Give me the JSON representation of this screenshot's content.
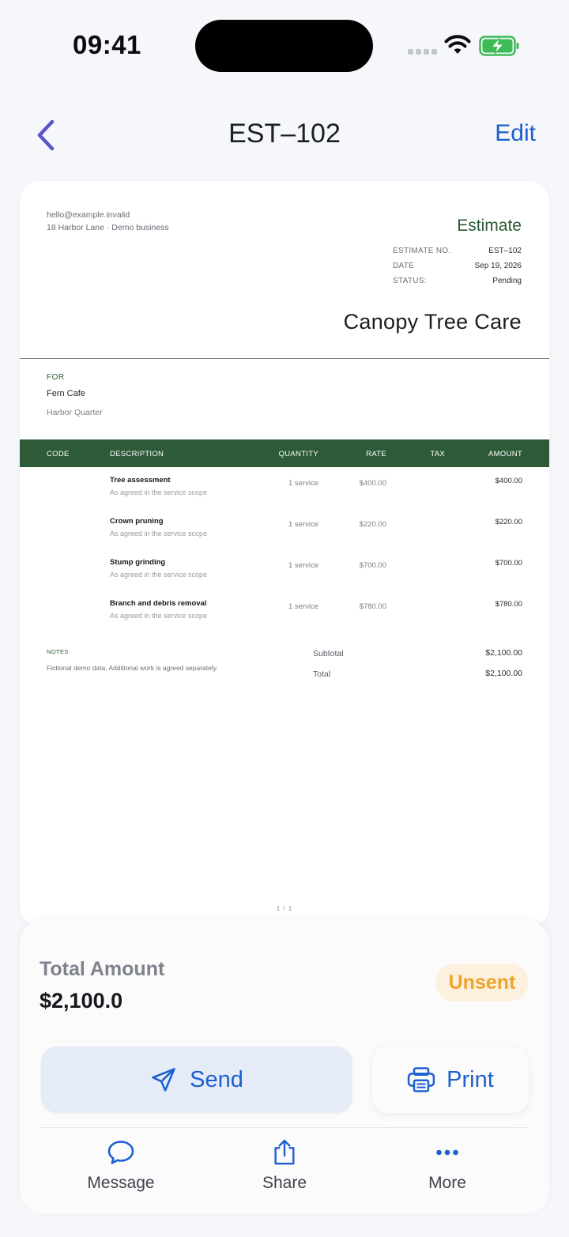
{
  "status_bar": {
    "time": "09:41"
  },
  "nav": {
    "title": "EST–102",
    "edit_label": "Edit"
  },
  "document": {
    "sender_email": "hello@example.invalid",
    "sender_address": "18 Harbor Lane · Demo business",
    "doc_type": "Estimate",
    "meta": [
      {
        "label": "ESTIMATE NO.",
        "value": "EST–102"
      },
      {
        "label": "DATE",
        "value": "Sep 19, 2026"
      },
      {
        "label": "STATUS:",
        "value": "Pending"
      }
    ],
    "company_name": "Canopy Tree Care",
    "for_label": "FOR",
    "client_name": "Fern Cafe",
    "client_address": "Harbor Quarter",
    "columns": {
      "code": "CODE",
      "description": "DESCRIPTION",
      "quantity": "QUANTITY",
      "rate": "RATE",
      "tax": "TAX",
      "amount": "AMOUNT"
    },
    "items": [
      {
        "description": "Tree assessment",
        "note": "As agreed in the service scope",
        "quantity": "1 service",
        "rate": "$400.00",
        "amount": "$400.00"
      },
      {
        "description": "Crown pruning",
        "note": "As agreed in the service scope",
        "quantity": "1 service",
        "rate": "$220.00",
        "amount": "$220.00"
      },
      {
        "description": "Stump grinding",
        "note": "As agreed in the service scope",
        "quantity": "1 service",
        "rate": "$700.00",
        "amount": "$700.00"
      },
      {
        "description": "Branch and debris removal",
        "note": "As agreed in the service scope",
        "quantity": "1 service",
        "rate": "$780.00",
        "amount": "$780.00"
      }
    ],
    "notes_label": "NOTES",
    "notes_text": "Fictional demo data. Additional work is agreed separately.",
    "subtotal_label": "Subtotal",
    "subtotal_value": "$2,100.00",
    "total_label": "Total",
    "total_value": "$2,100.00",
    "page_indicator": "1 / 1"
  },
  "sheet": {
    "total_label": "Total Amount",
    "total_value": "$2,100.0",
    "status_badge": "Unsent",
    "send_label": "Send",
    "print_label": "Print",
    "actions": [
      {
        "label": "Message",
        "icon": "message-icon"
      },
      {
        "label": "Share",
        "icon": "share-icon"
      },
      {
        "label": "More",
        "icon": "more-icon"
      }
    ]
  },
  "colors": {
    "accent_blue": "#1d5fcf",
    "doc_green": "#2e5b37",
    "badge_orange": "#f0a32c",
    "badge_bg": "#fcf1de",
    "back_arrow": "#5a55c8"
  }
}
